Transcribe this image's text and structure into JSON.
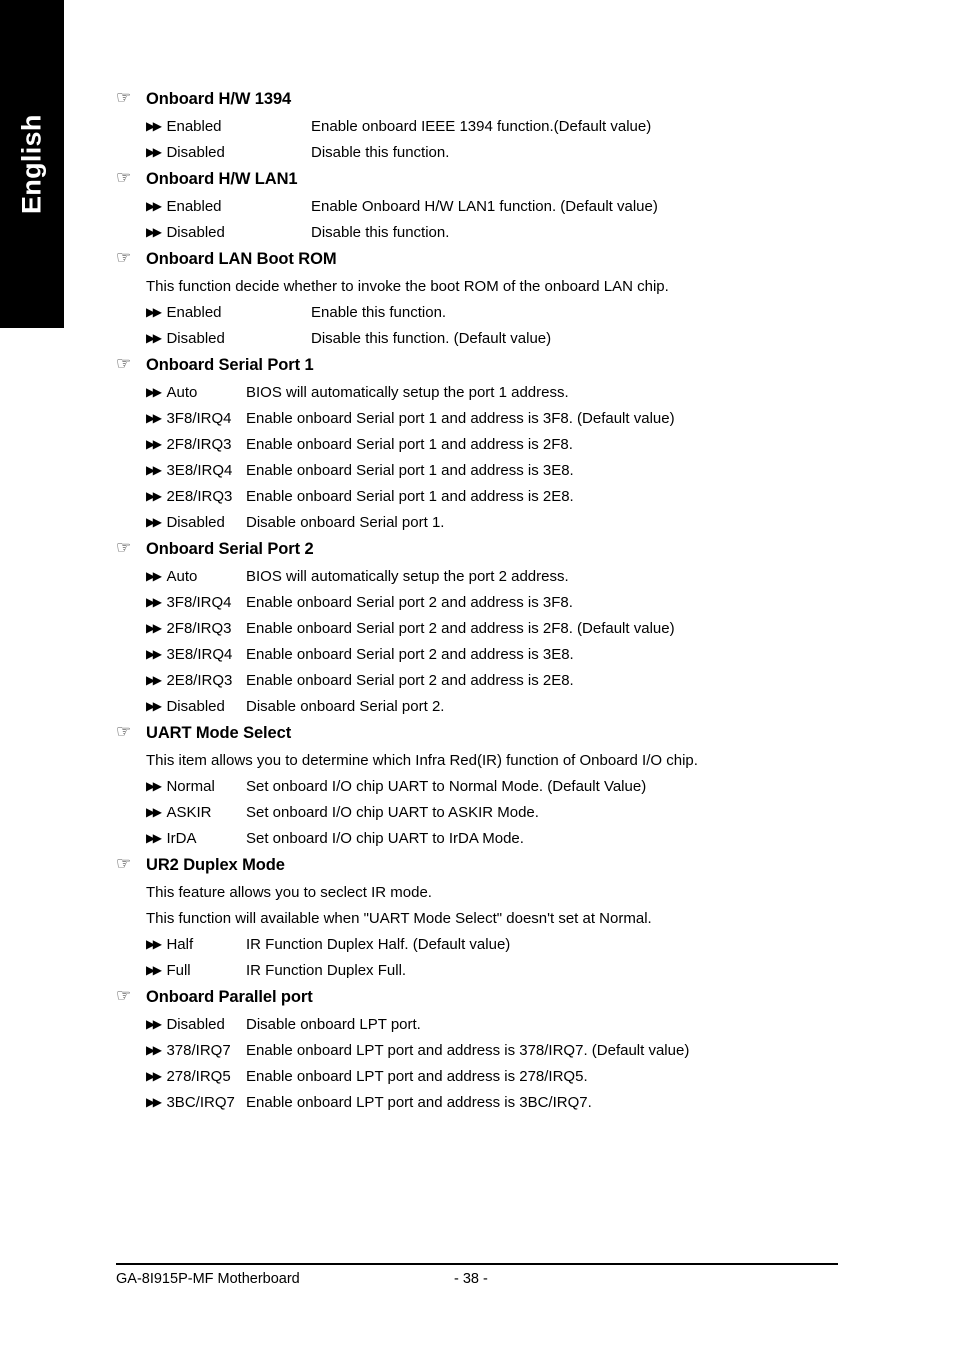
{
  "language_tab": {
    "label": "English"
  },
  "icons": {
    "hand": "☞",
    "arrows": "▶▶"
  },
  "sections": [
    {
      "id": "onboard-hw-1394",
      "title": "Onboard H/W 1394",
      "notes": [],
      "column_style": "wide",
      "options": [
        {
          "label": "Enabled",
          "desc": "Enable onboard IEEE 1394 function.(Default value)"
        },
        {
          "label": "Disabled",
          "desc": "Disable this function."
        }
      ]
    },
    {
      "id": "onboard-hw-lan1",
      "title": "Onboard H/W LAN1",
      "notes": [],
      "column_style": "wide",
      "options": [
        {
          "label": "Enabled",
          "desc": "Enable Onboard H/W LAN1 function. (Default value)"
        },
        {
          "label": "Disabled",
          "desc": "Disable this function."
        }
      ]
    },
    {
      "id": "onboard-lan-boot-rom",
      "title": "Onboard LAN Boot ROM",
      "notes": [
        "This function decide whether to invoke the boot ROM of the onboard LAN chip."
      ],
      "column_style": "wide",
      "options": [
        {
          "label": "Enabled",
          "desc": "Enable this function."
        },
        {
          "label": "Disabled",
          "desc": "Disable this function. (Default value)"
        }
      ]
    },
    {
      "id": "onboard-serial-port-1",
      "title": "Onboard Serial Port 1",
      "notes": [],
      "column_style": "narrow",
      "options": [
        {
          "label": "Auto",
          "desc": "BIOS will automatically setup the port 1 address."
        },
        {
          "label": "3F8/IRQ4",
          "desc": "Enable onboard Serial port 1 and address is 3F8. (Default value)"
        },
        {
          "label": "2F8/IRQ3",
          "desc": "Enable onboard Serial port 1 and address is 2F8."
        },
        {
          "label": "3E8/IRQ4",
          "desc": "Enable onboard Serial port 1 and address is 3E8."
        },
        {
          "label": "2E8/IRQ3",
          "desc": "Enable onboard Serial port 1 and address is 2E8."
        },
        {
          "label": "Disabled",
          "desc": "Disable onboard Serial port 1."
        }
      ]
    },
    {
      "id": "onboard-serial-port-2",
      "title": "Onboard Serial Port 2",
      "notes": [],
      "column_style": "narrow",
      "options": [
        {
          "label": "Auto",
          "desc": "BIOS will automatically setup the port 2 address."
        },
        {
          "label": "3F8/IRQ4",
          "desc": "Enable onboard Serial port 2 and address is 3F8."
        },
        {
          "label": "2F8/IRQ3",
          "desc": "Enable onboard Serial port 2 and address is 2F8. (Default value)"
        },
        {
          "label": "3E8/IRQ4",
          "desc": "Enable onboard Serial port 2 and address is 3E8."
        },
        {
          "label": "2E8/IRQ3",
          "desc": "Enable onboard Serial port 2 and address is 2E8."
        },
        {
          "label": "Disabled",
          "desc": "Disable onboard Serial port 2."
        }
      ]
    },
    {
      "id": "uart-mode-select",
      "title": "UART Mode Select",
      "notes": [
        "This item allows you to determine which Infra Red(IR) function of Onboard I/O chip."
      ],
      "column_style": "narrow",
      "options": [
        {
          "label": "Normal",
          "desc": "Set onboard I/O chip UART to Normal Mode. (Default Value)"
        },
        {
          "label": "ASKIR",
          "desc": "Set onboard I/O chip UART to ASKIR Mode."
        },
        {
          "label": "IrDA",
          "desc": "Set onboard I/O chip UART to IrDA Mode."
        }
      ]
    },
    {
      "id": "ur2-duplex-mode",
      "title": "UR2 Duplex Mode",
      "notes": [
        "This feature allows you to seclect IR mode.",
        "This function will available when \"UART Mode Select\" doesn't set at Normal."
      ],
      "column_style": "narrow",
      "options": [
        {
          "label": "Half",
          "desc": "IR Function Duplex Half. (Default value)"
        },
        {
          "label": "Full",
          "desc": "IR Function Duplex Full."
        }
      ]
    },
    {
      "id": "onboard-parallel-port",
      "title": "Onboard Parallel port",
      "notes": [],
      "column_style": "narrow",
      "options": [
        {
          "label": "Disabled",
          "desc": "Disable onboard LPT port."
        },
        {
          "label": "378/IRQ7",
          "desc": "Enable onboard LPT port and address is 378/IRQ7. (Default value)"
        },
        {
          "label": "278/IRQ5",
          "desc": "Enable onboard LPT port and address is 278/IRQ5."
        },
        {
          "label": "3BC/IRQ7",
          "desc": "Enable onboard LPT port and address is 3BC/IRQ7."
        }
      ]
    }
  ],
  "footer": {
    "title": "GA-8I915P-MF Motherboard",
    "page": "- 38 -"
  }
}
